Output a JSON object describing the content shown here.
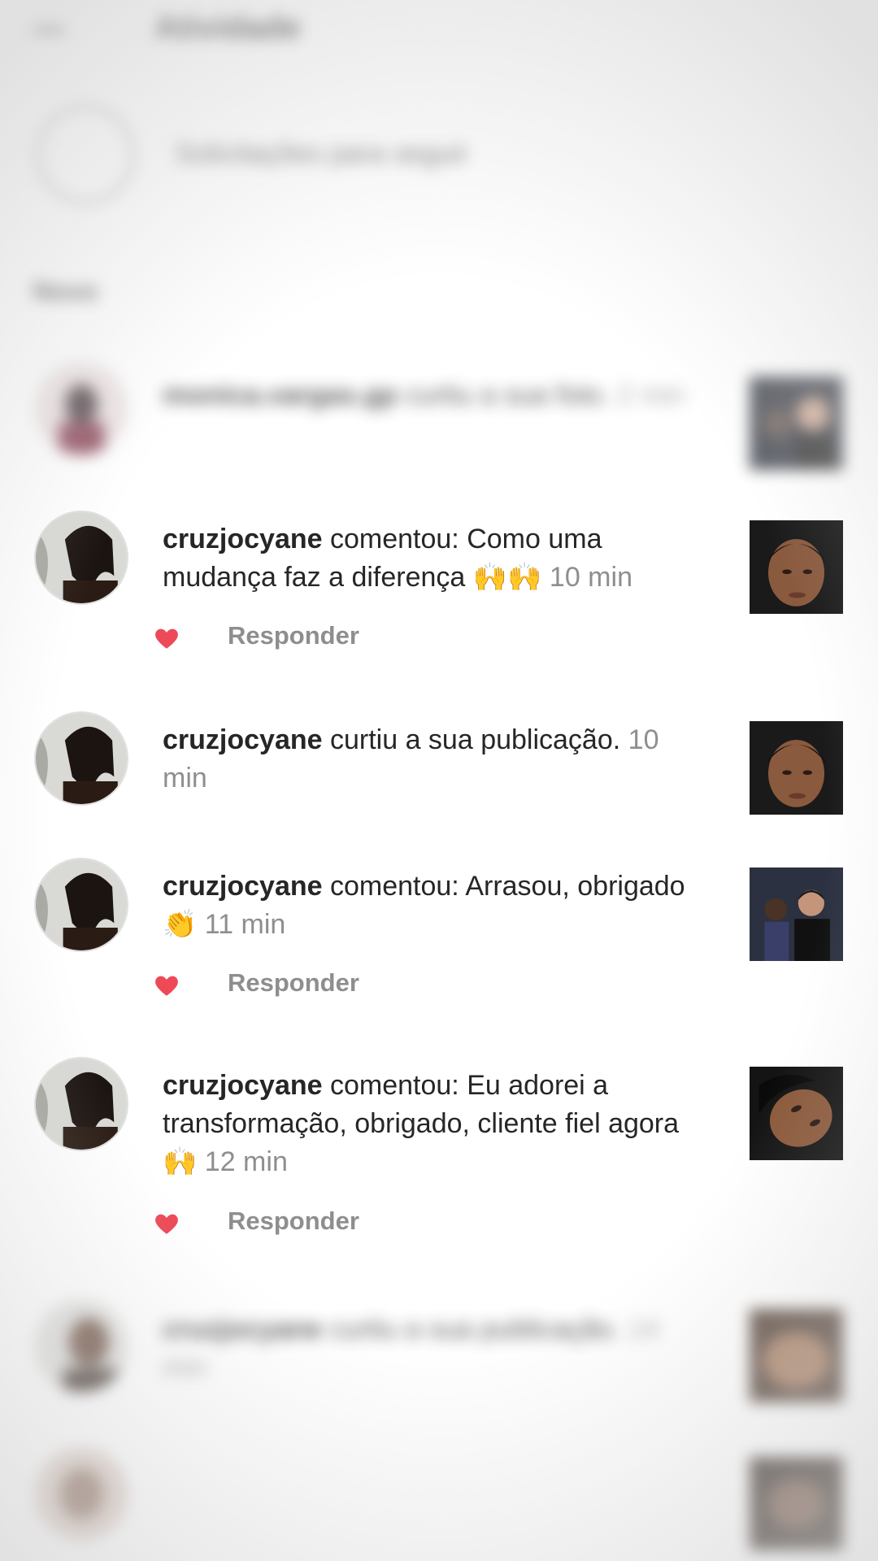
{
  "header": {
    "title": "Atividade"
  },
  "follow_requests": {
    "label": "Solicitações para seguir"
  },
  "section": {
    "label": "Novo"
  },
  "notifications": [
    {
      "user": "monica.vargas.gp",
      "action": "curtiu a sua foto.",
      "time": "2 min",
      "blurred": true
    },
    {
      "user": "cruzjocyane",
      "action": "comentou: Como uma mudança faz a diferença",
      "emoji": "🙌🙌",
      "time": "10 min",
      "reply": "Responder"
    },
    {
      "user": "cruzjocyane",
      "action": "curtiu a sua publicação.",
      "time": "10 min"
    },
    {
      "user": "cruzjocyane",
      "action": "comentou: Arrasou, obrigado",
      "emoji": "👏",
      "time": "11 min",
      "reply": "Responder"
    },
    {
      "user": "cruzjocyane",
      "action": "comentou: Eu adorei a transformação, obrigado, cliente fiel agora",
      "emoji": "🙌",
      "time": "12 min",
      "reply": "Responder"
    },
    {
      "user": "cruzjocyane",
      "action": "curtiu a sua publicação.",
      "time": "14 min",
      "blurred": true
    },
    {
      "user": "",
      "action": "",
      "time": "",
      "blurred": true
    }
  ],
  "colors": {
    "like": "#ed4956",
    "time": "#8e8e8e",
    "text": "#262626"
  },
  "icons": {
    "like": "heart-icon",
    "back": "back-arrow-icon"
  }
}
